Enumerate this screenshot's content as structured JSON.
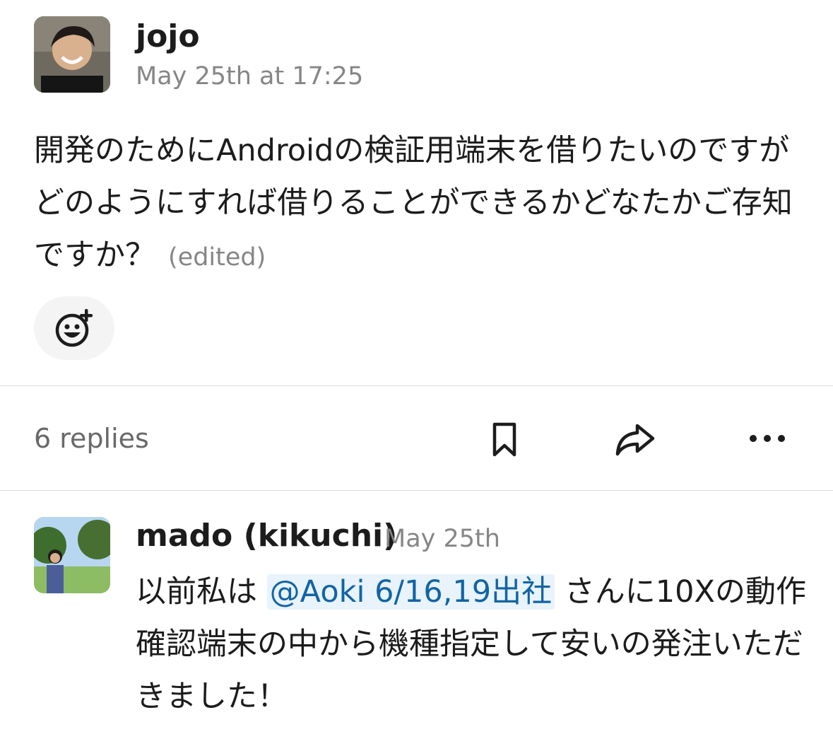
{
  "message": {
    "author": "jojo",
    "timestamp": "May 25th at 17:25",
    "text": "開発のためにAndroidの検証用端末を借りたいのですがどのようにすれば借りることができるかどなたかご存知ですか？",
    "edited_label": "(edited)"
  },
  "thread": {
    "replies_label": "6 replies"
  },
  "reply": {
    "author": "mado (kikuchi)",
    "timestamp": "May 25th",
    "text_before": "以前私は",
    "mention": "@Aoki 6/16,19出社",
    "text_after": "さんに10Xの動作確認端末の中から機種指定して安いの発注いただきました！"
  },
  "colors": {
    "link": "#1264a3",
    "mention_bg": "#e8f3fb",
    "muted_text": "#868686"
  }
}
